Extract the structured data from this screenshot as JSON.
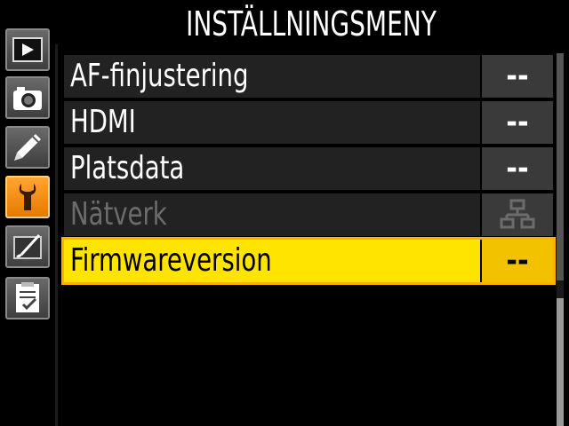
{
  "menu": {
    "title": "INSTÄLLNINGSMENY"
  },
  "tabs": [
    {
      "name": "playback-menu-tab",
      "icon": "play-icon",
      "active": false
    },
    {
      "name": "shooting-menu-tab",
      "icon": "camera-icon",
      "active": false
    },
    {
      "name": "custom-settings-tab",
      "icon": "pencil-icon",
      "active": false
    },
    {
      "name": "setup-menu-tab",
      "icon": "wrench-icon",
      "active": true
    },
    {
      "name": "retouch-menu-tab",
      "icon": "retouch-brush-icon",
      "active": false
    },
    {
      "name": "my-menu-tab",
      "icon": "checklist-icon",
      "active": false
    }
  ],
  "items": [
    {
      "label": "AF-finjustering",
      "value": "--",
      "state": "normal"
    },
    {
      "label": "HDMI",
      "value": "--",
      "state": "normal"
    },
    {
      "label": "Platsdata",
      "value": "--",
      "state": "normal"
    },
    {
      "label": "Nätverk",
      "value": "",
      "value_icon": "network-icon",
      "state": "disabled"
    },
    {
      "label": "Firmwareversion",
      "value": "--",
      "state": "selected"
    }
  ],
  "colors": {
    "selected_bg": "#ffe400",
    "active_tab": "#f28c00",
    "row_bg": "#222222",
    "disabled_text": "#6c6c6c"
  }
}
